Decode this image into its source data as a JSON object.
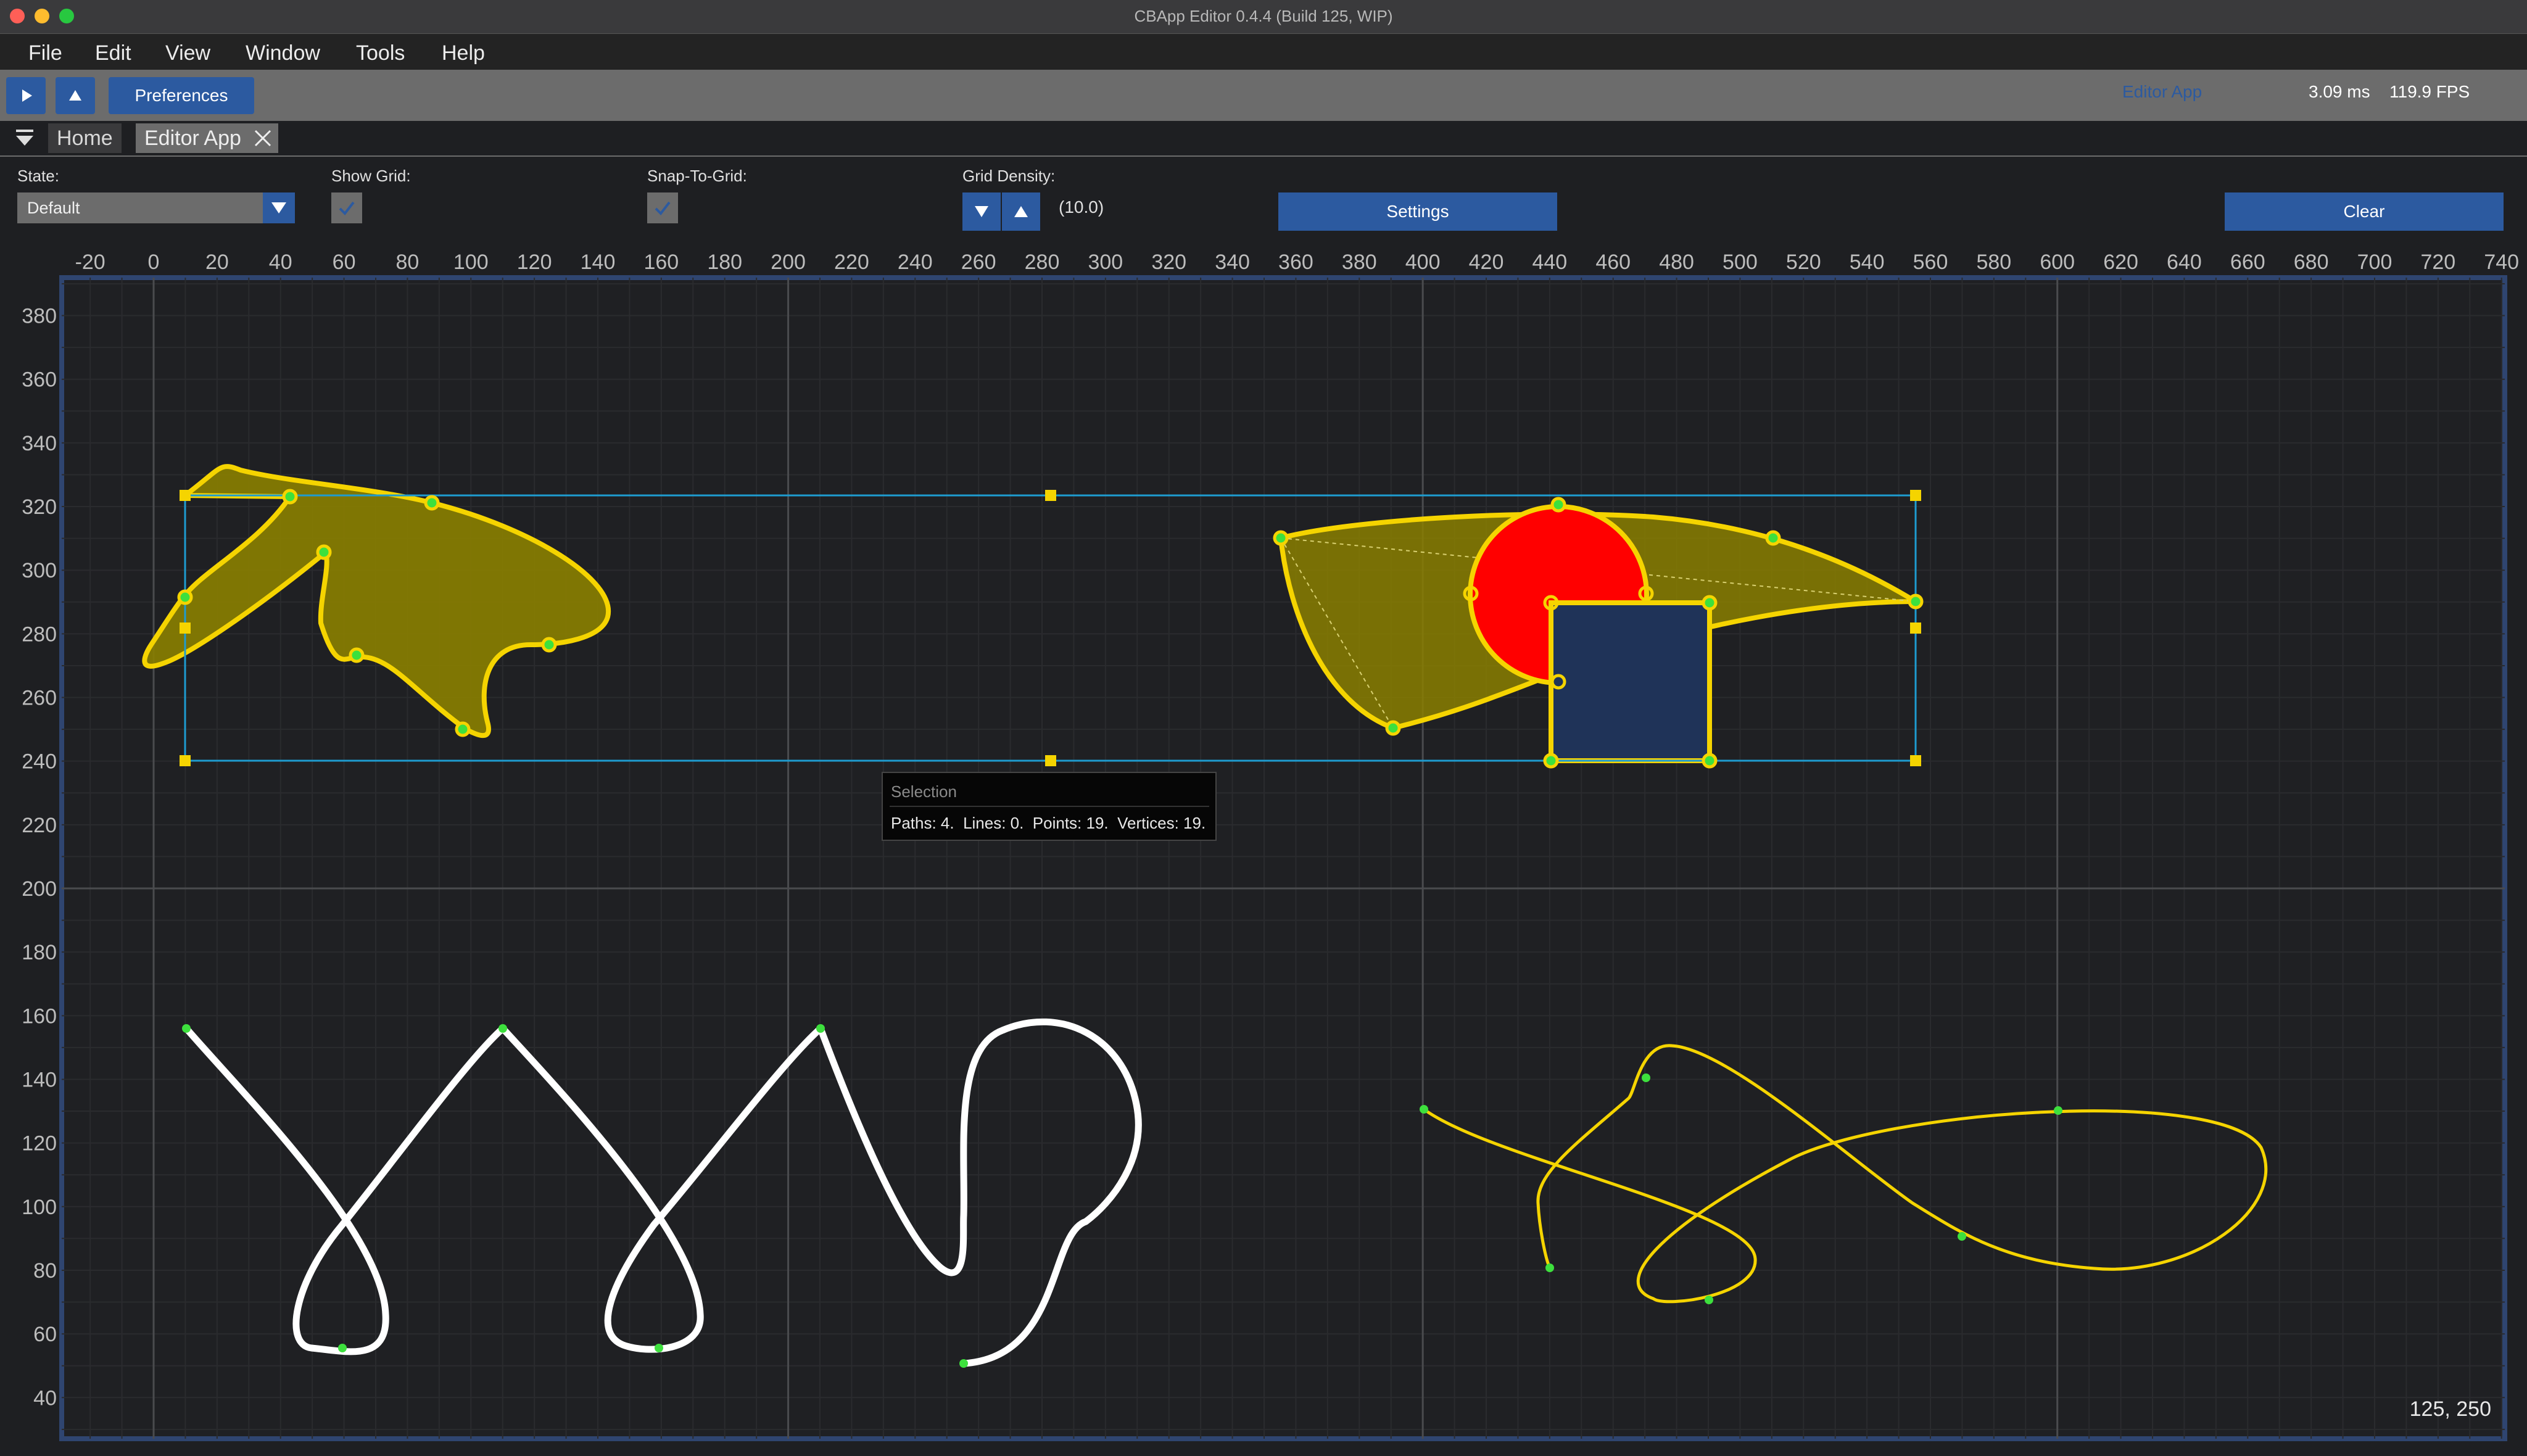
{
  "window": {
    "title": "CBApp Editor 0.4.4 (Build 125, WIP)"
  },
  "menu": [
    "File",
    "Edit",
    "View",
    "Window",
    "Tools",
    "Help"
  ],
  "toolbar": {
    "preferences_label": "Preferences",
    "active_app_label": "Editor App",
    "frame_time": "3.09 ms",
    "fps": "119.9 FPS"
  },
  "tabs": {
    "home": "Home",
    "editor": "Editor App"
  },
  "controls": {
    "state_label": "State:",
    "state_value": "Default",
    "show_grid_label": "Show Grid:",
    "snap_label": "Snap-To-Grid:",
    "density_label": "Grid Density:",
    "density_value": "(10.0)",
    "settings_label": "Settings",
    "clear_label": "Clear"
  },
  "canvas": {
    "x_ticks": [
      "-20",
      "0",
      "20",
      "40",
      "60",
      "80",
      "100",
      "120",
      "140",
      "160",
      "180",
      "200",
      "220",
      "240",
      "260",
      "280",
      "300",
      "320",
      "340",
      "360",
      "380",
      "400",
      "420",
      "440",
      "460",
      "480",
      "500",
      "520",
      "540",
      "560",
      "580",
      "600",
      "620",
      "640",
      "660",
      "680",
      "700",
      "720",
      "740"
    ],
    "y_ticks": [
      "380",
      "360",
      "340",
      "320",
      "300",
      "280",
      "260",
      "240",
      "220",
      "200",
      "180",
      "160",
      "140",
      "120",
      "100",
      "80",
      "60",
      "40"
    ],
    "selection_title": "Selection",
    "selection_info": "Paths: 4.  Lines: 0.  Points: 19.  Vertices: 19.",
    "cursor_readout": "125, 250"
  },
  "colors": {
    "accent": "#2c5aa0",
    "shape_stroke": "#f5d400",
    "shape_fill": "#8a7f00",
    "circle_fill": "#ff0000",
    "rect_fill": "#1f3358",
    "selection_box": "#1e9cd0",
    "vertex": "#3de03d"
  }
}
